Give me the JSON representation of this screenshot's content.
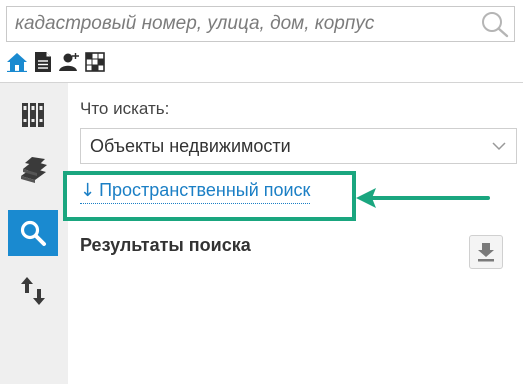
{
  "search": {
    "placeholder": "кадастровый номер, улица, дом, корпус",
    "search_icon": "magnifier-icon"
  },
  "mode_tabs": [
    {
      "icon": "home-icon"
    },
    {
      "icon": "document-icon"
    },
    {
      "icon": "person-icon"
    },
    {
      "icon": "grid-icon"
    }
  ],
  "sidebar": {
    "items": [
      {
        "icon": "layers-binders-icon"
      },
      {
        "icon": "books-icon"
      },
      {
        "icon": "search-icon",
        "active": true
      },
      {
        "icon": "swap-arrows-icon"
      }
    ]
  },
  "panel": {
    "what_label": "Что искать:",
    "select_value": "Объекты недвижимости",
    "spatial_link_arrow": "↓",
    "spatial_link_text": "Пространственный поиск",
    "results_title": "Результаты поиска",
    "download_icon": "download-icon"
  },
  "colors": {
    "accent_blue": "#1a8ad0",
    "link_blue": "#1b7fc5",
    "highlight_green": "#1aa67f",
    "sidebar_bg": "#efefef"
  }
}
